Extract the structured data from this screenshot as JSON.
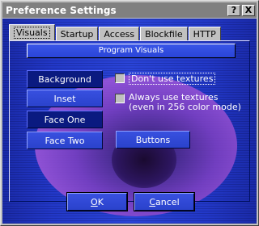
{
  "window": {
    "title": "Preference Settings"
  },
  "titlebar": {
    "help_glyph": "?",
    "close_glyph": "X"
  },
  "tabs": [
    {
      "label": "Visuals",
      "active": true
    },
    {
      "label": "Startup",
      "active": false
    },
    {
      "label": "Access",
      "active": false
    },
    {
      "label": "Blockfile",
      "active": false
    },
    {
      "label": "HTTP",
      "active": false
    }
  ],
  "section": {
    "header": "Program Visuals"
  },
  "style_buttons": [
    {
      "label": "Background"
    },
    {
      "label": "Inset"
    },
    {
      "label": "Face One"
    },
    {
      "label": "Face Two"
    }
  ],
  "options": {
    "no_textures": {
      "label": "Don't use textures",
      "checked": false
    },
    "always_textures": {
      "line1": "Always use textures",
      "line2": "(even in 256 color mode)",
      "checked": false
    }
  },
  "buttons_button": {
    "label": "Buttons"
  },
  "footer": {
    "ok_prefix": "O",
    "ok_rest": "K",
    "cancel_prefix": "C",
    "cancel_rest": "ancel"
  },
  "colors": {
    "panel": "#2238c8",
    "titlebar": "#808080",
    "eye": "#9b55d8"
  }
}
